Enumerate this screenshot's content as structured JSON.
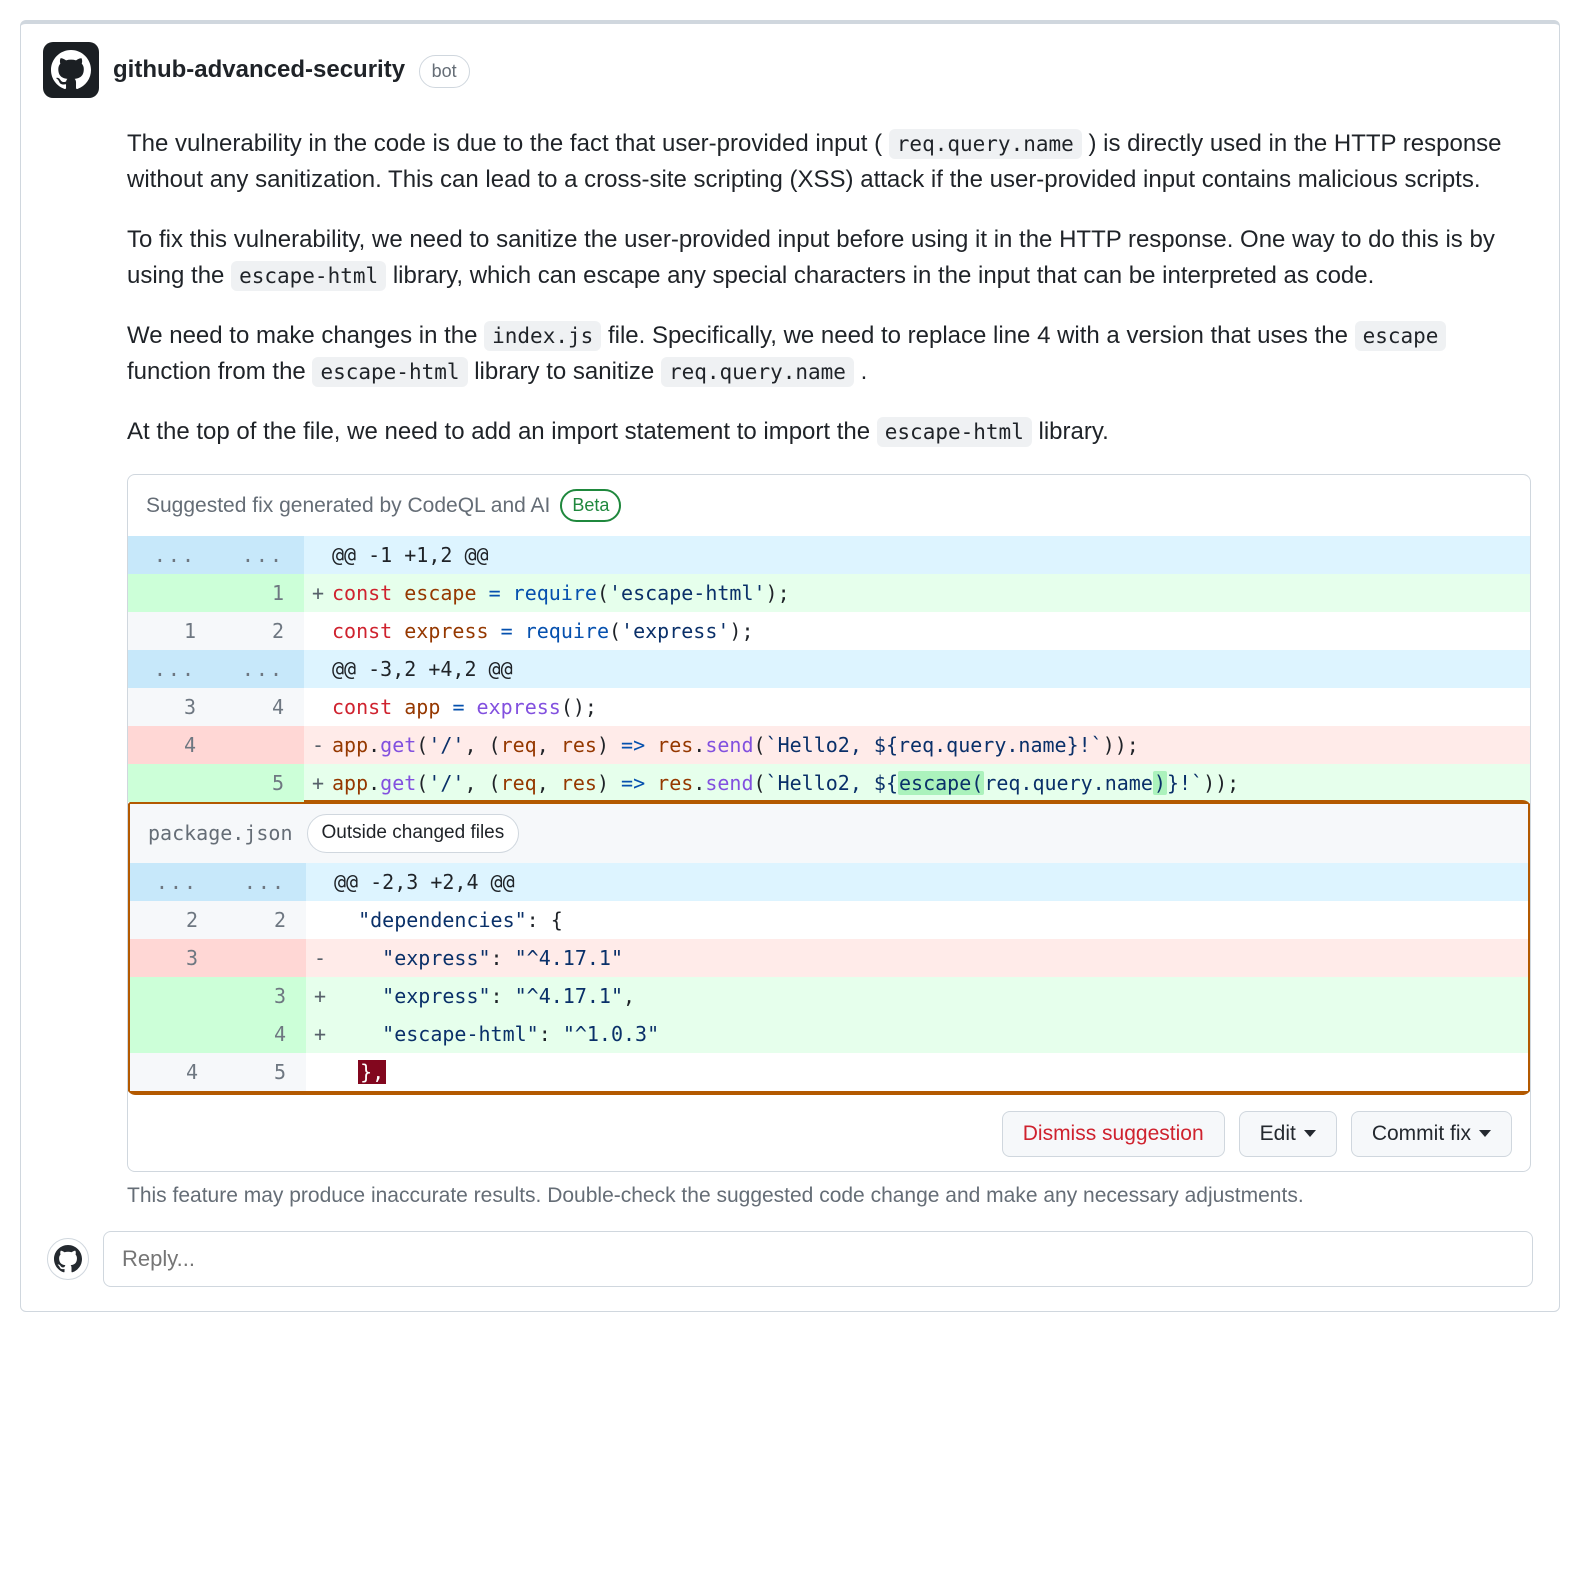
{
  "author": "github-advanced-security",
  "bot_badge": "bot",
  "paragraphs": {
    "p1a": "The vulnerability in the code is due to the fact that user-provided input (",
    "p1_code": "req.query.name",
    "p1b": ") is directly used in the HTTP response without any sanitization. This can lead to a cross-site scripting (XSS) attack if the user-provided input contains malicious scripts.",
    "p2a": "To fix this vulnerability, we need to sanitize the user-provided input before using it in the HTTP response. One way to do this is by using the ",
    "p2_code": "escape-html",
    "p2b": " library, which can escape any special characters in the input that can be interpreted as code.",
    "p3a": "We need to make changes in the ",
    "p3_code1": "index.js",
    "p3b": " file. Specifically, we need to replace line 4 with a version that uses the ",
    "p3_code2": "escape",
    "p3c": " function from the ",
    "p3_code3": "escape-html",
    "p3d": " library to sanitize ",
    "p3_code4": "req.query.name",
    "p3e": ".",
    "p4a": "At the top of the file, we need to add an import statement to import the ",
    "p4_code": "escape-html",
    "p4b": " library."
  },
  "suggestion": {
    "header": "Suggested fix generated by CodeQL and AI",
    "beta": "Beta",
    "file2_name": "package.json",
    "outside_label": "Outside changed files",
    "diff1": {
      "hunk1": "@@ -1 +1,2 @@",
      "r1": {
        "old": "",
        "new": "1",
        "sign": "+",
        "html": "<span class='c-kw'>const</span> <span class='c-param'>escape</span> <span class='c-op'>=</span> <span class='c-call'>require</span>(<span class='c-str'>'escape-html'</span>);"
      },
      "r2": {
        "old": "1",
        "new": "2",
        "sign": "",
        "html": "<span class='c-kw'>const</span> <span class='c-param'>express</span> <span class='c-op'>=</span> <span class='c-call'>require</span>(<span class='c-str'>'express'</span>);"
      },
      "hunk2": "@@ -3,2 +4,2 @@",
      "r3": {
        "old": "3",
        "new": "4",
        "sign": "",
        "html": "<span class='c-kw'>const</span> <span class='c-param'>app</span> <span class='c-op'>=</span> <span class='c-fn'>express</span>();"
      },
      "r4": {
        "old": "4",
        "new": "",
        "sign": "-",
        "html": "<span class='c-param'>app</span>.<span class='c-fn'>get</span>(<span class='c-str'>'/'</span>, (<span class='c-param'>req</span>, <span class='c-param'>res</span>) <span class='c-op'>=></span> <span class='c-param'>res</span>.<span class='c-fn'>send</span>(<span class='c-str'>`Hello2, ${req.query.name}!`</span>));"
      },
      "r5": {
        "old": "",
        "new": "5",
        "sign": "+",
        "html": "<span class='c-param'>app</span>.<span class='c-fn'>get</span>(<span class='c-str'>'/'</span>, (<span class='c-param'>req</span>, <span class='c-param'>res</span>) <span class='c-op'>=></span> <span class='c-param'>res</span>.<span class='c-fn'>send</span>(<span class='c-str'>`Hello2, ${<span class='hl-green'>escape(</span>req.query.name<span class='hl-green'>)</span>}!`</span>));"
      }
    },
    "diff2": {
      "hunk1": "@@ -2,3 +2,4 @@",
      "r1": {
        "old": "2",
        "new": "2",
        "sign": "",
        "html": "  <span class='c-str'>\"dependencies\"</span>: {"
      },
      "r2": {
        "old": "3",
        "new": "",
        "sign": "-",
        "html": "    <span class='c-str'>\"express\"</span>: <span class='c-str'>\"^4.17.1\"</span>"
      },
      "r3": {
        "old": "",
        "new": "3",
        "sign": "+",
        "html": "    <span class='c-str'>\"express\"</span>: <span class='c-str'>\"^4.17.1\"</span>,"
      },
      "r4": {
        "old": "",
        "new": "4",
        "sign": "+",
        "html": "    <span class='c-str'>\"escape-html\"</span>: <span class='c-str'>\"^1.0.3\"</span>"
      },
      "r5": {
        "old": "4",
        "new": "5",
        "sign": "",
        "html": "  <span class='hl-redbox'>},</span>"
      }
    }
  },
  "actions": {
    "dismiss": "Dismiss suggestion",
    "edit": "Edit",
    "commit": "Commit fix"
  },
  "footnote": "This feature may produce inaccurate results. Double-check the suggested code change and make any necessary adjustments.",
  "reply_placeholder": "Reply..."
}
